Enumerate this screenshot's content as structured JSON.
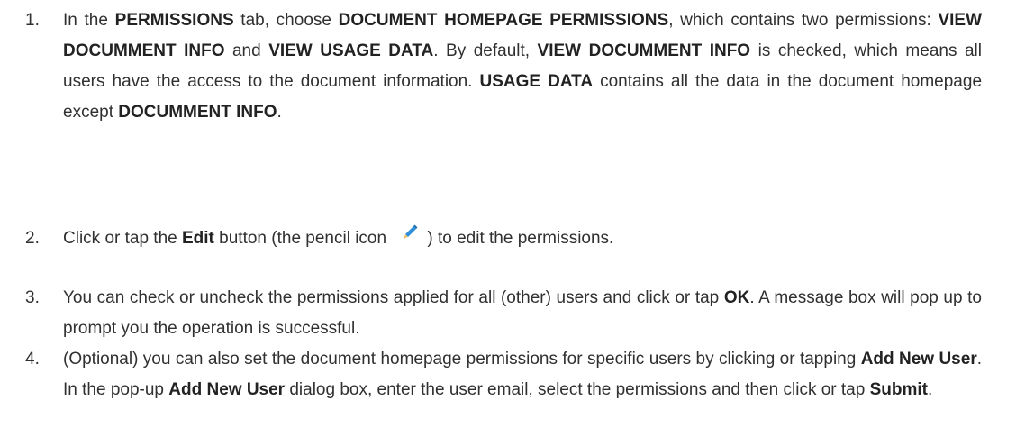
{
  "steps": [
    {
      "number": "1.",
      "parts": [
        {
          "t": "In the ",
          "b": false
        },
        {
          "t": "PERMISSIONS",
          "b": true
        },
        {
          "t": " tab, choose ",
          "b": false
        },
        {
          "t": "DOCUMENT HOMEPAGE PERMISSIONS",
          "b": true
        },
        {
          "t": ", which contains two permissions: ",
          "b": false
        },
        {
          "t": "VIEW DOCUMMENT INFO",
          "b": true
        },
        {
          "t": " and ",
          "b": false
        },
        {
          "t": "VIEW USAGE DATA",
          "b": true
        },
        {
          "t": ". By default, ",
          "b": false
        },
        {
          "t": "VIEW DOCUMMENT INFO",
          "b": true
        },
        {
          "t": " is checked, which means all users have the access to the document information. ",
          "b": false
        },
        {
          "t": "USAGE DATA",
          "b": true
        },
        {
          "t": " contains all the data in the document homepage except ",
          "b": false
        },
        {
          "t": "DOCUMMENT INFO",
          "b": true
        },
        {
          "t": ".",
          "b": false
        }
      ]
    },
    {
      "number": "2.",
      "parts": [
        {
          "t": "Click or tap the ",
          "b": false
        },
        {
          "t": "Edit",
          "b": true
        },
        {
          "t": " button (the pencil icon ",
          "b": false
        },
        {
          "icon": "pencil-icon"
        },
        {
          "t": ") to edit the permissions.",
          "b": false
        }
      ]
    },
    {
      "number": "3.",
      "parts": [
        {
          "t": "You can check or uncheck the permissions applied for all (other) users and click or tap ",
          "b": false
        },
        {
          "t": "OK",
          "b": true
        },
        {
          "t": ". A message box will pop up to prompt you the operation is successful.",
          "b": false
        }
      ]
    },
    {
      "number": "4.",
      "parts": [
        {
          "t": "(Optional) you can also set the document homepage permissions for specific users by clicking or tapping ",
          "b": false
        },
        {
          "t": "Add New User",
          "b": true
        },
        {
          "t": ". In the pop-up ",
          "b": false
        },
        {
          "t": "Add New User",
          "b": true
        },
        {
          "t": " dialog box, enter the user email, select the permissions and then click or tap ",
          "b": false
        },
        {
          "t": "Submit",
          "b": true
        },
        {
          "t": ".",
          "b": false
        }
      ]
    }
  ],
  "colors": {
    "text": "#303030",
    "pencil": "#2f8fd8",
    "pencil_tip": "#f2c36b"
  }
}
